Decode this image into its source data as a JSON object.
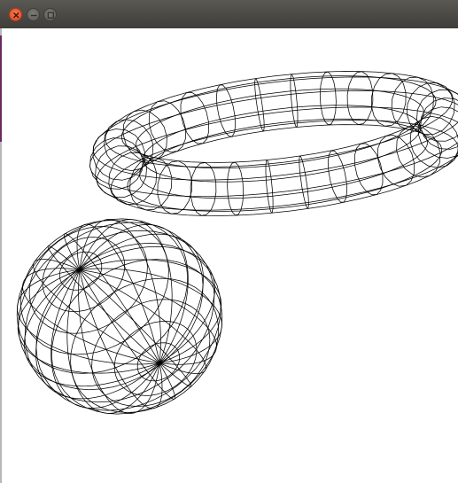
{
  "window": {
    "title": "",
    "controls": {
      "close": "close",
      "minimize": "minimize",
      "maximize": "maximize"
    }
  },
  "scene": {
    "background": "#ffffff",
    "stroke": "#000000",
    "objects": [
      {
        "kind": "torus",
        "render": "wireframe"
      },
      {
        "kind": "sphere",
        "render": "wireframe"
      }
    ]
  },
  "colors": {
    "titlebar": "#4a4945",
    "close": "#e95420",
    "accent": "#6b2a5d"
  }
}
